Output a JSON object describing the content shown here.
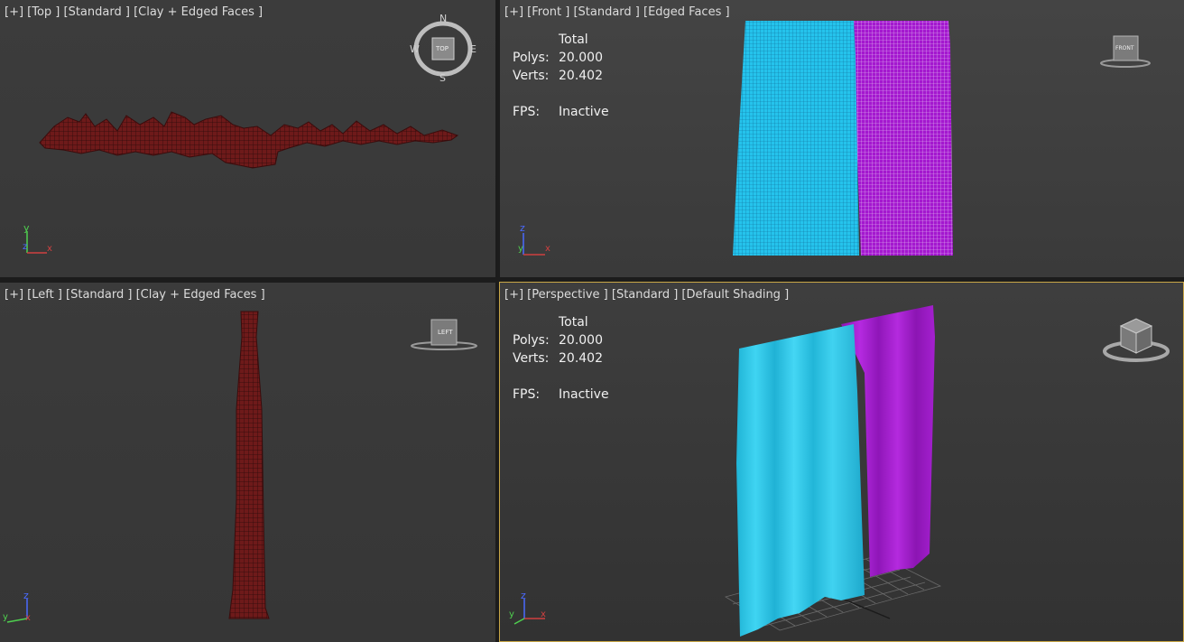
{
  "viewports": {
    "top": {
      "label": "[+] [Top ] [Standard ] [Clay + Edged Faces ]",
      "cube": "TOP",
      "compass": {
        "n": "N",
        "s": "S",
        "e": "E",
        "w": "W"
      },
      "axes": {
        "up": "y",
        "right": "x",
        "depth": "z"
      }
    },
    "front": {
      "label": "[+] [Front ] [Standard ] [Edged Faces ]",
      "cube": "FRONT",
      "axes": {
        "up": "z",
        "right": "x",
        "depth": "y"
      },
      "stats": {
        "total_label": "Total",
        "polys_label": "Polys:",
        "polys": "20.000",
        "verts_label": "Verts:",
        "verts": "20.402",
        "fps_label": "FPS:",
        "fps": "Inactive"
      }
    },
    "left": {
      "label": "[+] [Left ] [Standard ] [Clay + Edged Faces ]",
      "cube": "LEFT",
      "axes": {
        "up": "z",
        "right": "x",
        "depth": "y"
      }
    },
    "perspective": {
      "label": "[+] [Perspective ] [Standard ] [Default Shading ]",
      "axes": {
        "up": "z",
        "right": "x",
        "depth": "y"
      },
      "stats": {
        "total_label": "Total",
        "polys_label": "Polys:",
        "polys": "20.000",
        "verts_label": "Verts:",
        "verts": "20.402",
        "fps_label": "FPS:",
        "fps": "Inactive"
      }
    }
  },
  "colors": {
    "curtain_cyan": "#2bc8e8",
    "curtain_magenta": "#a81bd0",
    "clay_red": "#7a1e1e",
    "active_border": "#c8a646"
  }
}
